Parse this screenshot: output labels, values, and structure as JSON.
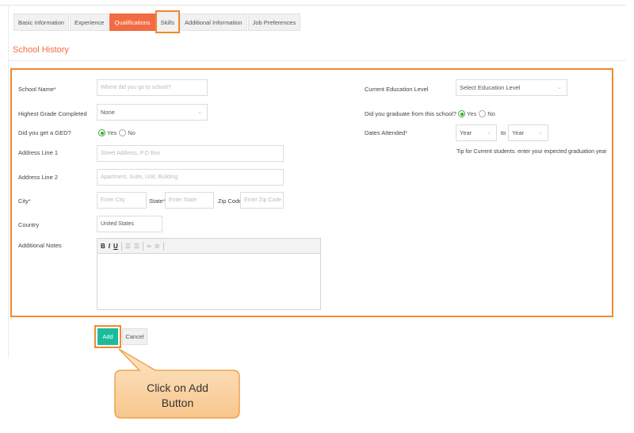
{
  "tabs": [
    {
      "label": "Basic Information",
      "state": "default"
    },
    {
      "label": "Experience",
      "state": "default"
    },
    {
      "label": "Qualifications",
      "state": "active"
    },
    {
      "label": "Skills",
      "state": "highlighted"
    },
    {
      "label": "Additional Information",
      "state": "default"
    },
    {
      "label": "Job Preferences",
      "state": "default"
    }
  ],
  "section_title": "School History",
  "form": {
    "school_name": {
      "label": "School Name",
      "required": "*",
      "placeholder": "Where did you go to school?"
    },
    "highest_grade": {
      "label": "Highest Grade Completed",
      "value": "None"
    },
    "ged": {
      "label": "Did you get a GED?",
      "yes": "Yes",
      "no": "No",
      "selected": "Yes"
    },
    "address1": {
      "label": "Address Line 1",
      "placeholder": "Street Address, P.O Box"
    },
    "address2": {
      "label": "Address Line 2",
      "placeholder": "Apartment, Suite, Unit, Building"
    },
    "city": {
      "label": "City",
      "required": "*",
      "placeholder": "Enter City"
    },
    "state": {
      "label": "State",
      "required": "*",
      "placeholder": "Enter State"
    },
    "zip": {
      "label": "Zip Code",
      "placeholder": "Enter Zip Code"
    },
    "country": {
      "label": "Country",
      "value": "United States"
    },
    "notes": {
      "label": "Additional Notes"
    },
    "education_level": {
      "label": "Current Education Level",
      "value": "Select Education Level"
    },
    "graduated": {
      "label": "Did you graduate from this school?",
      "yes": "Yes",
      "no": "No",
      "selected": "Yes"
    },
    "dates": {
      "label": "Dates Attended",
      "required": "*",
      "from": "Year",
      "to_label": "to",
      "to": "Year"
    },
    "tip": "Tip for Current students: enter your expected graduation year"
  },
  "editor_toolbar": {
    "bold": "B",
    "italic": "I",
    "underline": "U"
  },
  "buttons": {
    "add": "Add",
    "cancel": "Cancel"
  },
  "callout": {
    "line1": "Click on Add",
    "line2": "Button"
  },
  "colors": {
    "accent": "#f26b43",
    "highlight_border": "#f08a2c",
    "add_button": "#1bbc9b",
    "radio_on": "#3ba935",
    "callout_fill": "#fbd3a3"
  }
}
